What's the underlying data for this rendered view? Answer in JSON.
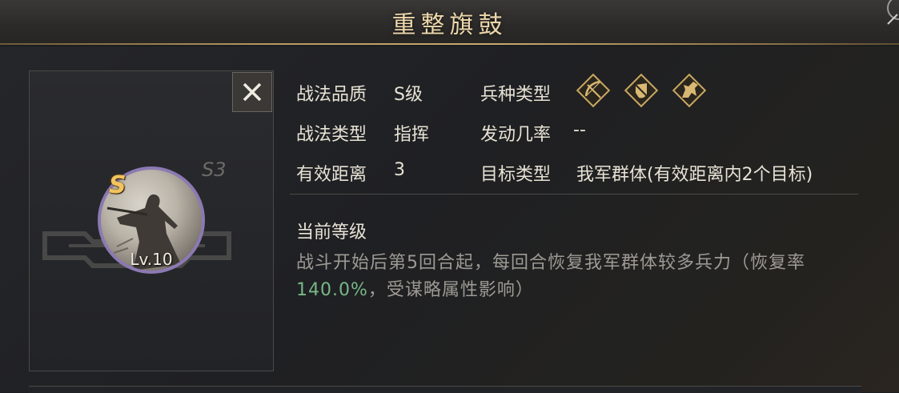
{
  "header": {
    "title": "重整旗鼓"
  },
  "card": {
    "grade_letter": "S",
    "season": "S3",
    "level": "Lv.10",
    "close_label": "✕"
  },
  "info": {
    "quality_label": "战法品质",
    "quality_value": "S级",
    "type_label": "战法类型",
    "type_value": "指挥",
    "range_label": "有效距离",
    "range_value": "3",
    "troop_label": "兵种类型",
    "troop_icons": [
      "bow-icon",
      "shield-icon",
      "horse-icon"
    ],
    "trigger_label": "发动几率",
    "trigger_value": "--",
    "target_label": "目标类型",
    "target_value": "我军群体(有效距离内2个目标)"
  },
  "level_section": {
    "title": "当前等级",
    "desc_before": "战斗开始后第5回合起，每回合恢复我军群体较多兵力（恢复率",
    "rate": "140.0%",
    "desc_after": "，受谋略属性影响）"
  },
  "colors": {
    "title_gold": "#ecd7ab",
    "portrait_ring": "#8b79b3",
    "grade_gold": "#f3c45d",
    "rate_green": "#78b788"
  }
}
